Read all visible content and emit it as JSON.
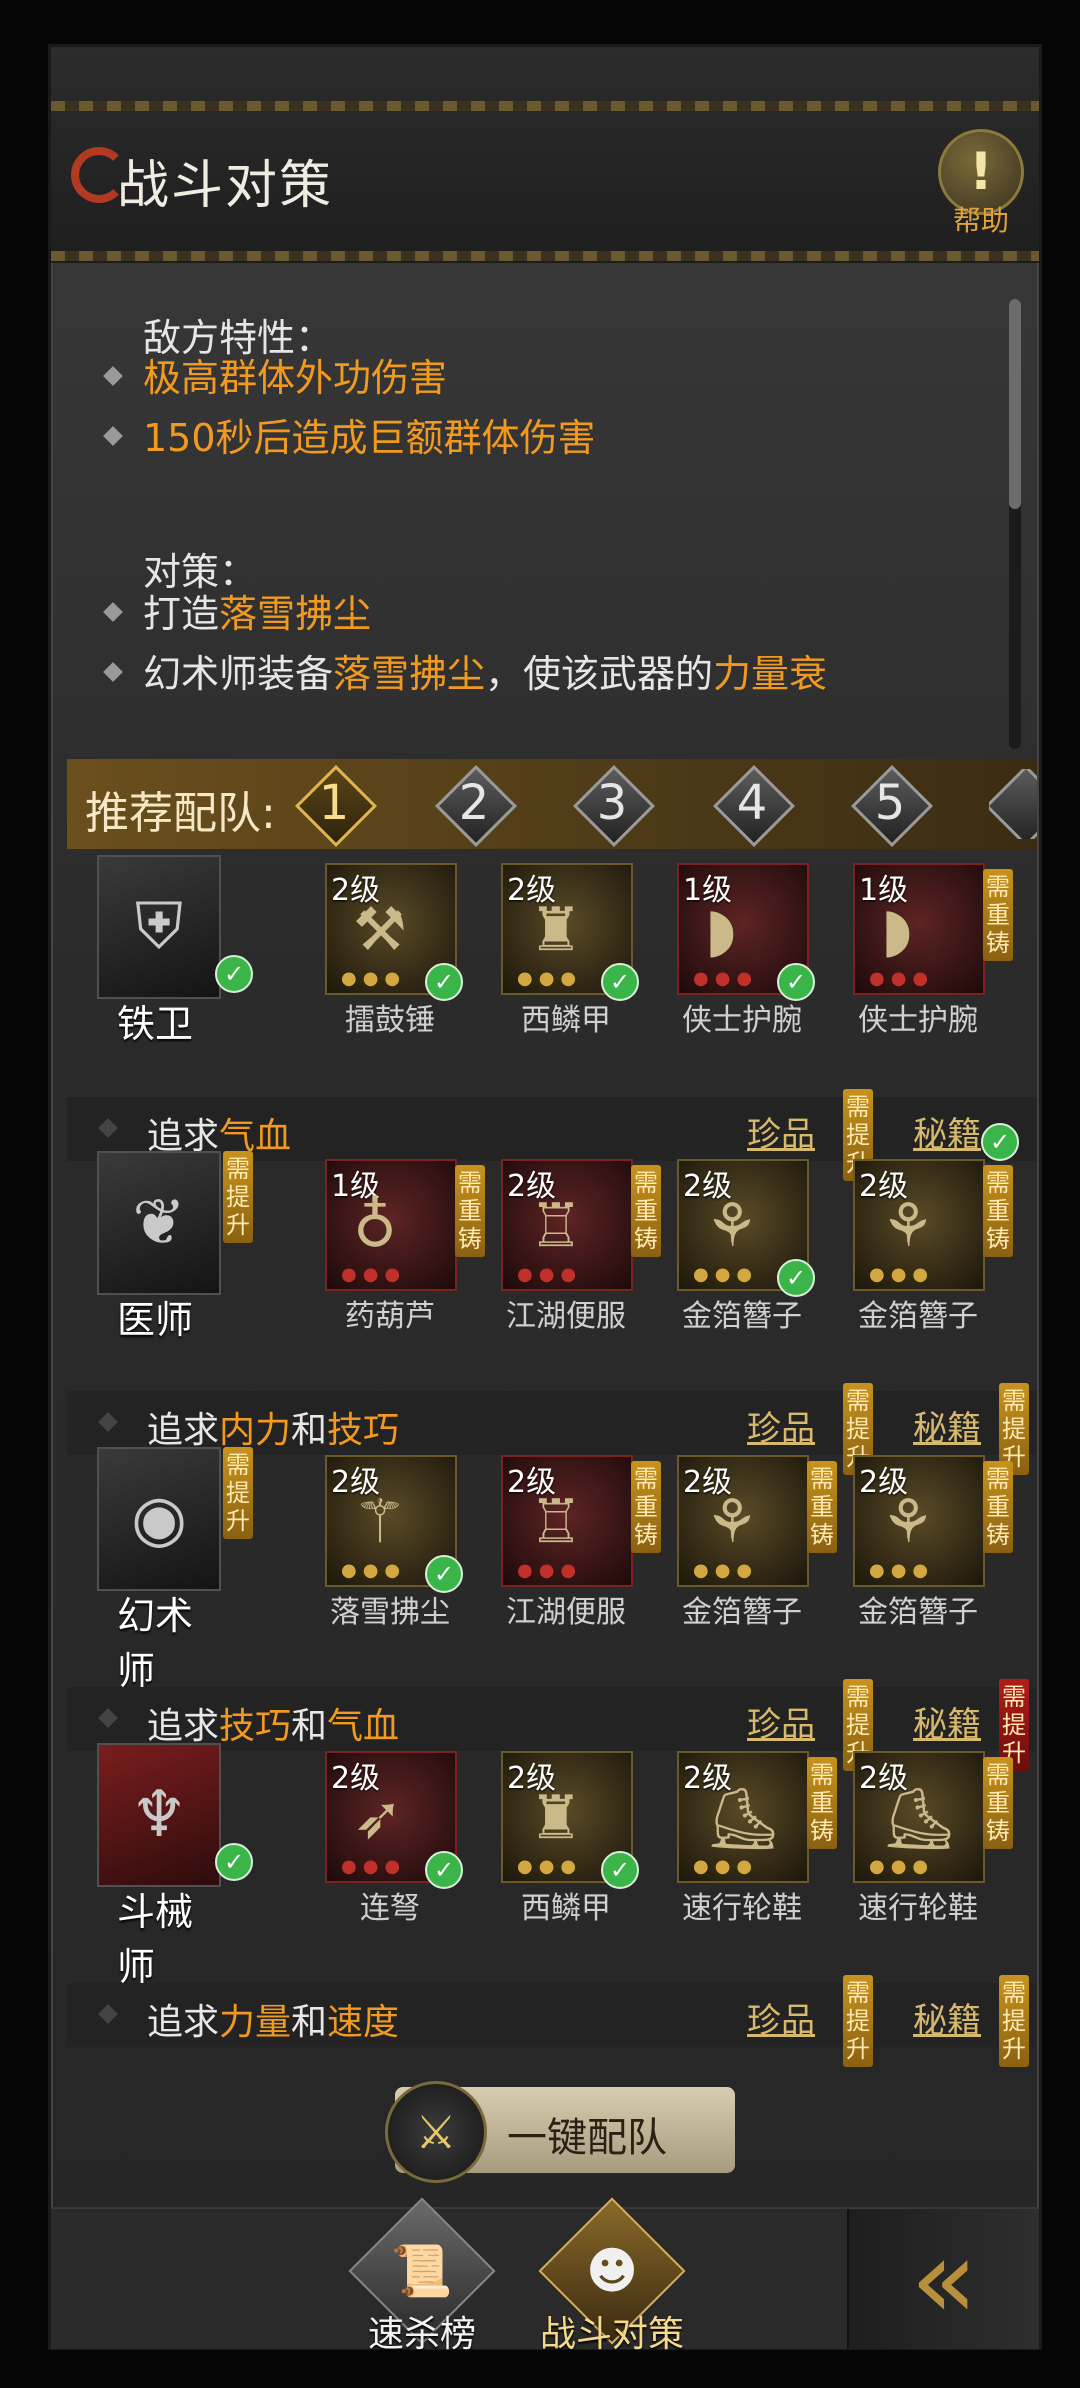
{
  "title": "战斗对策",
  "help_label": "帮助",
  "enemy": {
    "heading": "敌方特性：",
    "traits": [
      "极高群体外功伤害",
      "150秒后造成巨额群体伤害"
    ]
  },
  "strategy": {
    "heading": "对策：",
    "line1_prefix": "打造",
    "line1_highlight": "落雪拂尘",
    "line2_prefix": "幻术师装备",
    "line2_highlight1": "落雪拂尘",
    "line2_mid": "，使该武器的",
    "line2_highlight2": "力量衰"
  },
  "recommend": {
    "label": "推荐配队:",
    "tabs": [
      "1",
      "2",
      "3",
      "4",
      "5"
    ],
    "selected": 1
  },
  "roles": [
    {
      "name": "铁卫",
      "items": [
        {
          "level": "2级",
          "name": "擂鼓锤"
        },
        {
          "level": "2级",
          "name": "西鳞甲"
        },
        {
          "level": "1级",
          "name": "侠士护腕"
        },
        {
          "level": "1级",
          "name": "侠士护腕"
        }
      ],
      "pursue_prefix": "追求",
      "pursue_h1": "气血",
      "pursue_mid": "",
      "pursue_h2": ""
    },
    {
      "name": "医师",
      "items": [
        {
          "level": "1级",
          "name": "药葫芦"
        },
        {
          "level": "2级",
          "name": "江湖便服"
        },
        {
          "level": "2级",
          "name": "金箔簪子"
        },
        {
          "level": "2级",
          "name": "金箔簪子"
        }
      ],
      "pursue_prefix": "追求",
      "pursue_h1": "内力",
      "pursue_mid": "和",
      "pursue_h2": "技巧"
    },
    {
      "name": "幻术师",
      "items": [
        {
          "level": "2级",
          "name": "落雪拂尘"
        },
        {
          "level": "2级",
          "name": "江湖便服"
        },
        {
          "level": "2级",
          "name": "金箔簪子"
        },
        {
          "level": "2级",
          "name": "金箔簪子"
        }
      ],
      "pursue_prefix": "追求",
      "pursue_h1": "技巧",
      "pursue_mid": "和",
      "pursue_h2": "气血"
    },
    {
      "name": "斗械师",
      "items": [
        {
          "level": "2级",
          "name": "连弩"
        },
        {
          "level": "2级",
          "name": "西鳞甲"
        },
        {
          "level": "2级",
          "name": "速行轮鞋"
        },
        {
          "level": "2级",
          "name": "速行轮鞋"
        }
      ],
      "pursue_prefix": "追求",
      "pursue_h1": "力量",
      "pursue_mid": "和",
      "pursue_h2": "速度"
    }
  ],
  "treasure_label": "珍品",
  "manual_label": "秘籍",
  "need_upgrade": "需提升",
  "need_recast": "需重铸",
  "onekey_label": "一键配队",
  "bottom_tabs": [
    {
      "label": "速杀榜",
      "icon": "scroll-icon"
    },
    {
      "label": "战斗对策",
      "icon": "fighter-icon"
    }
  ],
  "colors": {
    "accent_orange": "#f29a1f",
    "gold": "#d7b96c",
    "check_green": "#3bb54a",
    "alert_red": "#b41b1b"
  }
}
